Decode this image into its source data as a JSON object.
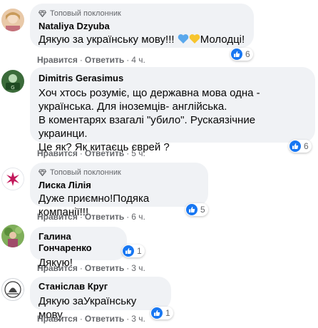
{
  "labels": {
    "top_fan": "Топовый поклонник",
    "like": "Нравится",
    "reply": "Ответить",
    "dot": "·"
  },
  "comments": [
    {
      "name": "Nataliya Dzyuba",
      "top_fan": true,
      "text": "Дякую за українську мову!!!",
      "emoji": [
        "blue-heart",
        "yellow-heart"
      ],
      "text_after": "Молодці!",
      "time": "4 ч.",
      "reactions": "6"
    },
    {
      "name": "Dimitris Gerasimus",
      "top_fan": false,
      "text": "Хоч хтось розуміє, що державна мова одна -\nукраїнська. Для іноземців- англійська.\nВ коментарях взагалі \"убило\". Рускаязічние украинци.\nЦе як? Як китаєць єврей ?",
      "time": "5 ч.",
      "reactions": "6"
    },
    {
      "name": "Лиска Лілія",
      "top_fan": true,
      "text": "Дуже приємно!Подяка компанії!!!",
      "time": "6 ч.",
      "reactions": "5"
    },
    {
      "name": "Галина Гончаренко",
      "top_fan": false,
      "text": "Дякую!",
      "time": "3 ч.",
      "reactions": "1"
    },
    {
      "name": "Станіслав Круг",
      "top_fan": false,
      "text": "Дякую заУкраїнську мову.",
      "time": "3 ч.",
      "reactions": "1"
    }
  ],
  "colors": {
    "bubble": "#f0f2f5",
    "like_blue": "#1877f2",
    "meta_gray": "#65676b",
    "blue_heart": "#5aa8ec",
    "yellow_heart": "#f7c52e"
  }
}
